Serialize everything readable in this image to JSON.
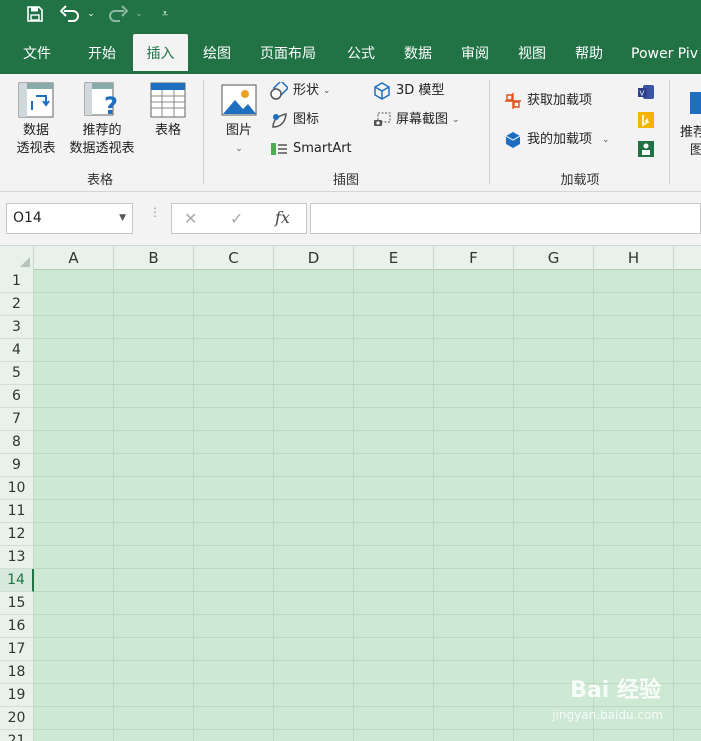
{
  "ribbon_tabs": [
    "文件",
    "开始",
    "插入",
    "绘图",
    "页面布局",
    "公式",
    "数据",
    "审阅",
    "视图",
    "帮助",
    "Power Piv"
  ],
  "active_tab": "插入",
  "groups": {
    "tables": {
      "label": "表格",
      "pivot_line1": "数据",
      "pivot_line2": "透视表",
      "recommended_line1": "推荐的",
      "recommended_line2": "数据透视表",
      "table": "表格"
    },
    "illustrations": {
      "label": "插图",
      "pictures": "图片",
      "shapes": "形状",
      "icons": "图标",
      "smartart": "SmartArt",
      "model3d": "3D 模型",
      "screenshot": "屏幕截图"
    },
    "addins": {
      "label": "加载项",
      "get": "获取加载项",
      "my": "我的加载项"
    },
    "cut_off": {
      "line1": "推荐",
      "line2": "图"
    }
  },
  "formula_bar": {
    "name_box": "O14",
    "fx": "fx",
    "cancel": "✕",
    "enter": "✓",
    "value": ""
  },
  "columns": [
    "A",
    "B",
    "C",
    "D",
    "E",
    "F",
    "G",
    "H"
  ],
  "rows": [
    "1",
    "2",
    "3",
    "4",
    "5",
    "6",
    "7",
    "8",
    "9",
    "10",
    "11",
    "12",
    "13",
    "14",
    "15",
    "16",
    "17",
    "18",
    "19",
    "20",
    "21"
  ],
  "active_row": "14",
  "colors": {
    "accent": "#217346",
    "grid_fill": "#cde8d3"
  },
  "watermark": {
    "brand": "Bai 经验",
    "url": "jingyan.baidu.com"
  }
}
